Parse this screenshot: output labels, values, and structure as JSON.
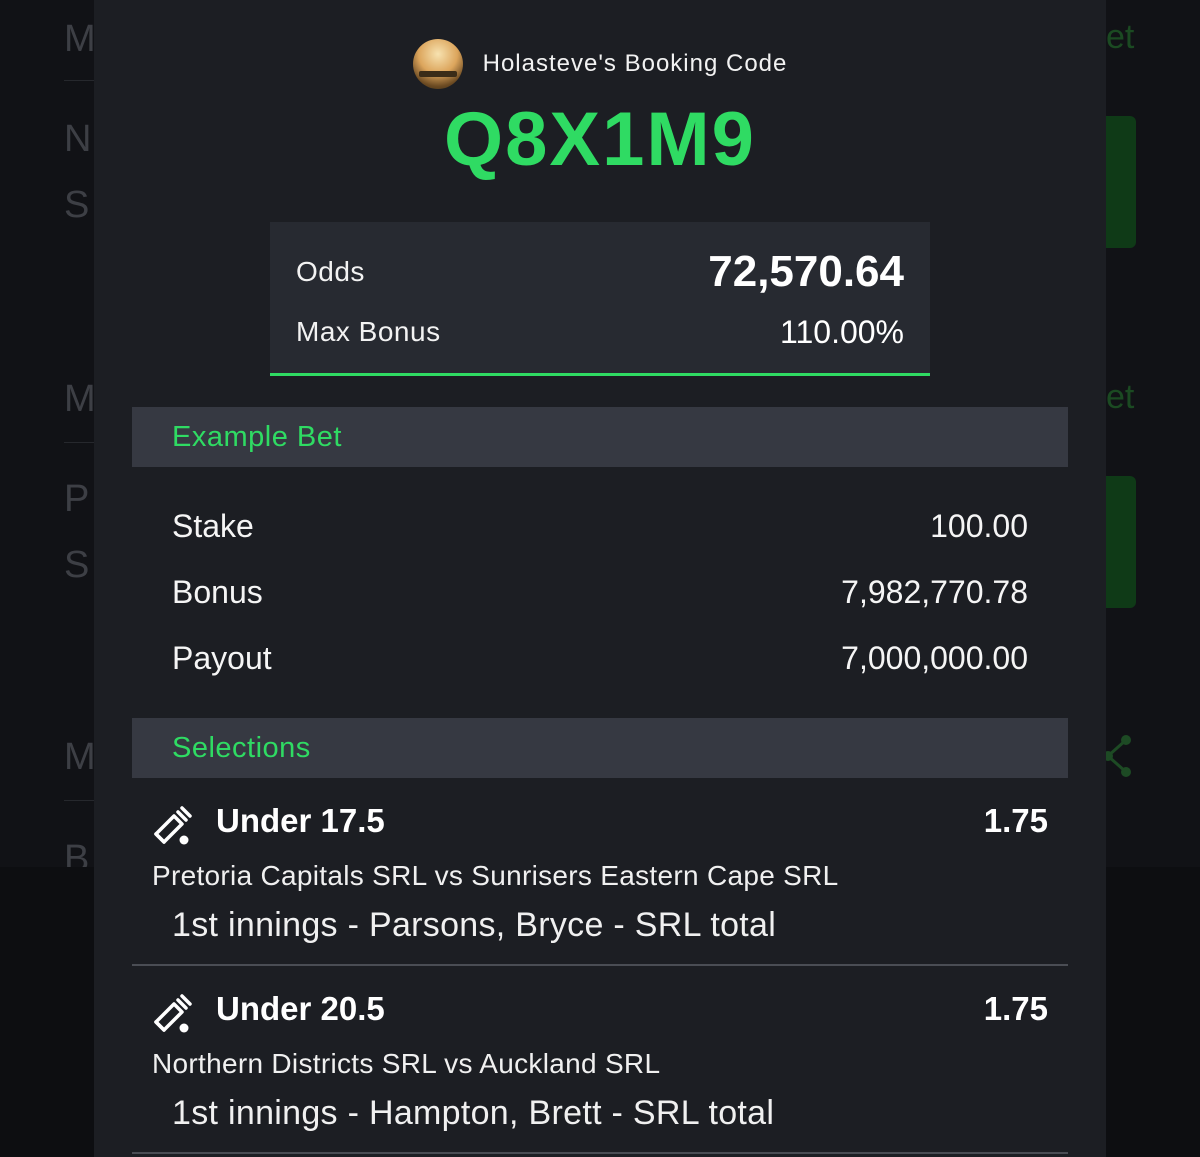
{
  "background": {
    "letters": [
      "M",
      "N",
      "S",
      "M",
      "P",
      "S",
      "M",
      "B"
    ],
    "right_fragments": [
      "et",
      "et"
    ]
  },
  "header": {
    "avatar_icon": "avatar-sunset-photo",
    "owner_label": "Holasteve's Booking Code",
    "booking_code": "Q8X1M9"
  },
  "summary": {
    "odds_label": "Odds",
    "odds_value": "72,570.64",
    "max_bonus_label": "Max Bonus",
    "max_bonus_value": "110.00%"
  },
  "example_bet": {
    "title": "Example Bet",
    "rows": [
      {
        "label": "Stake",
        "value": "100.00"
      },
      {
        "label": "Bonus",
        "value": "7,982,770.78"
      },
      {
        "label": "Payout",
        "value": "7,000,000.00"
      }
    ]
  },
  "selections": {
    "title": "Selections",
    "items": [
      {
        "icon": "cricket-bat-icon",
        "pick": "Under 17.5",
        "odds": "1.75",
        "match": "Pretoria Capitals SRL vs Sunrisers Eastern Cape SRL",
        "market": "1st innings - Parsons, Bryce - SRL total"
      },
      {
        "icon": "cricket-bat-icon",
        "pick": "Under 20.5",
        "odds": "1.75",
        "match": "Northern Districts SRL vs Auckland SRL",
        "market": "1st innings - Hampton, Brett - SRL total"
      }
    ]
  },
  "colors": {
    "accent": "#2fdb63",
    "modal_bg": "#1c1e23",
    "card_bg": "#272a31",
    "section_bg": "#363942"
  }
}
